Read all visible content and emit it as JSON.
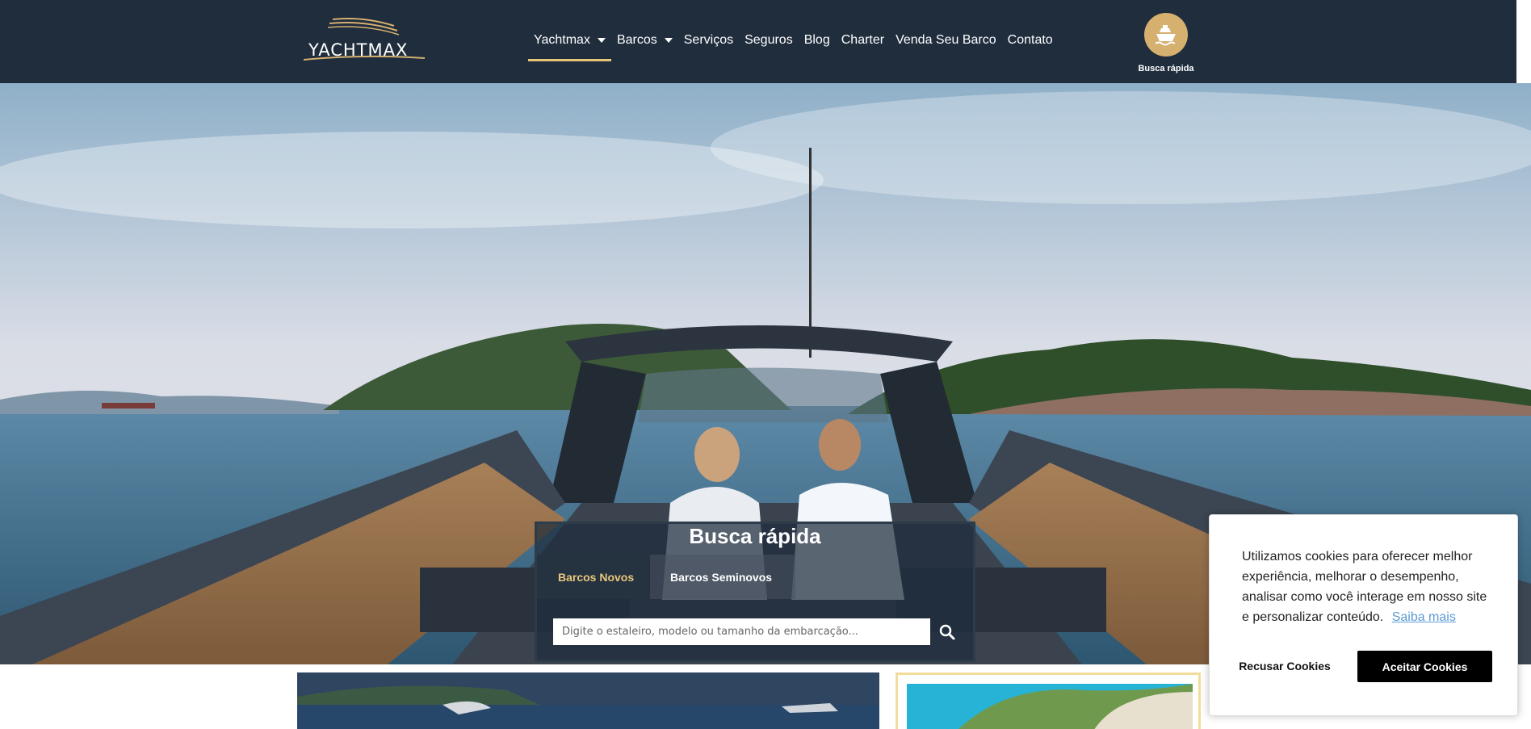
{
  "header": {
    "logo_text": "YACHTMAX",
    "nav": [
      {
        "label": "Yachtmax",
        "has_dropdown": true,
        "active": true
      },
      {
        "label": "Barcos",
        "has_dropdown": true,
        "active": false
      },
      {
        "label": "Serviços",
        "has_dropdown": false,
        "active": false
      },
      {
        "label": "Seguros",
        "has_dropdown": false,
        "active": false
      },
      {
        "label": "Blog",
        "has_dropdown": false,
        "active": false
      },
      {
        "label": "Charter",
        "has_dropdown": false,
        "active": false
      },
      {
        "label": "Venda Seu Barco",
        "has_dropdown": false,
        "active": false
      },
      {
        "label": "Contato",
        "has_dropdown": false,
        "active": false
      }
    ],
    "quick_search_label": "Busca rápida",
    "quick_search_icon": "boat-icon"
  },
  "search": {
    "title": "Busca rápida",
    "tabs": [
      {
        "label": "Barcos Novos",
        "active": true
      },
      {
        "label": "Barcos Seminovos",
        "active": false
      }
    ],
    "placeholder": "Digite o estaleiro, modelo ou tamanho da embarcação...",
    "button_icon": "search-icon"
  },
  "cookie": {
    "message": "Utilizamos cookies para oferecer melhor experiência, melhorar o desempenho, analisar como você interage em nosso site e personalizar conteúdo.",
    "link_label": "Saiba mais",
    "deny_label": "Recusar Cookies",
    "accept_label": "Aceitar Cookies"
  },
  "colors": {
    "header_bg": "#1f2d3d",
    "accent_gold": "#d5b06f",
    "active_tab_text": "#e8c77b",
    "cookie_link": "#5b9bd5"
  }
}
